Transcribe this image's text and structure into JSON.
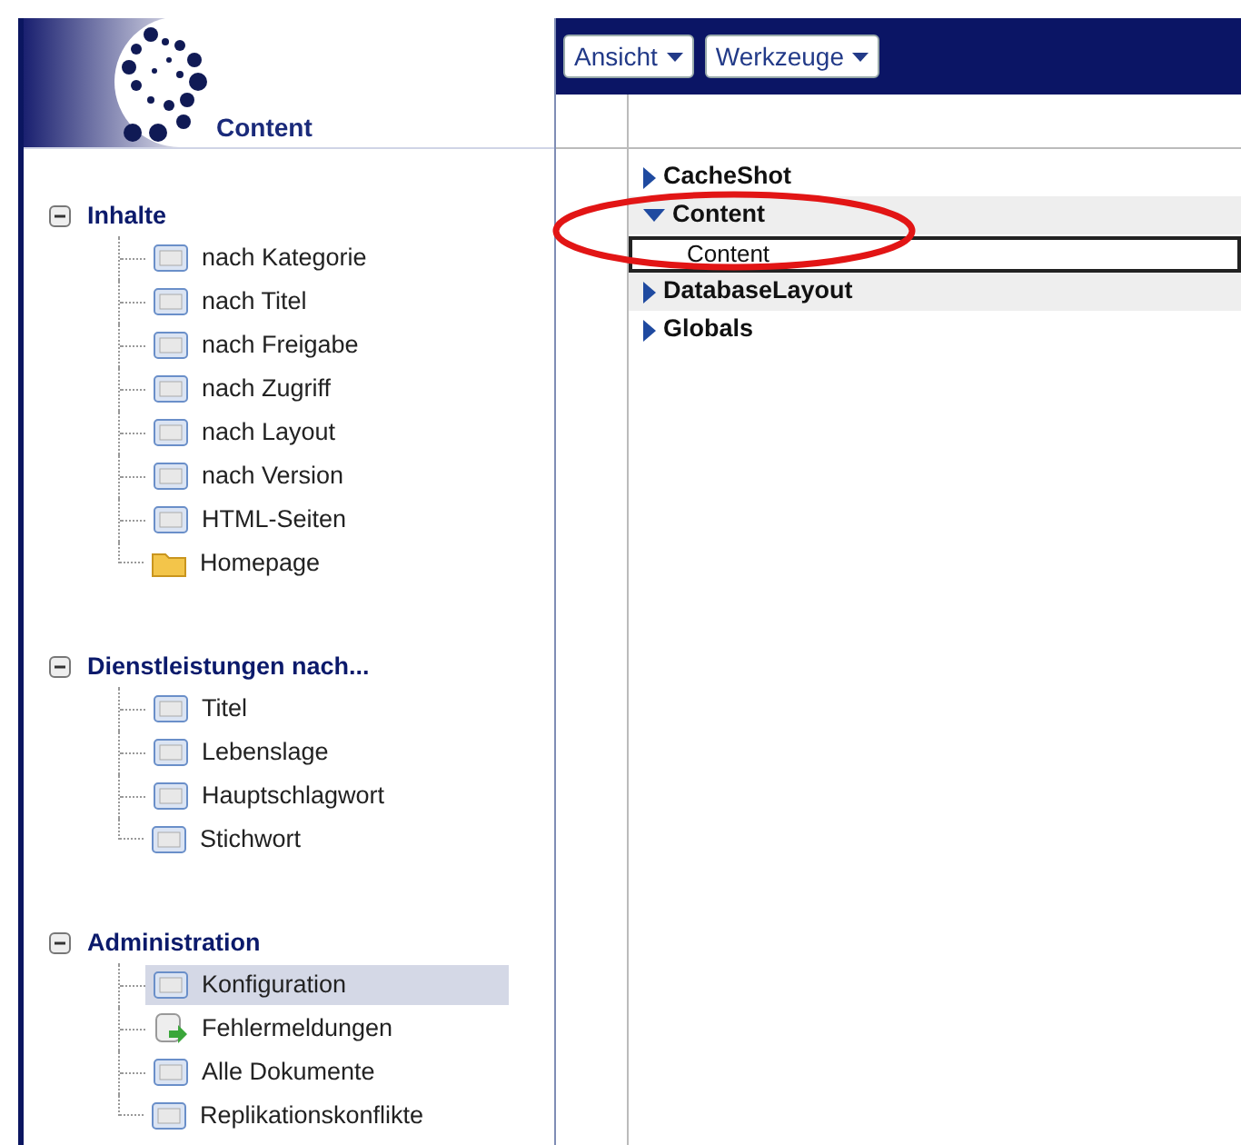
{
  "logo": {
    "title": "Content"
  },
  "sidebar": {
    "sections": [
      {
        "title": "Inhalte",
        "expanded": true,
        "items": [
          {
            "label": "nach Kategorie",
            "kind": "view",
            "selected": false
          },
          {
            "label": "nach Titel",
            "kind": "view",
            "selected": false
          },
          {
            "label": "nach Freigabe",
            "kind": "view",
            "selected": false
          },
          {
            "label": "nach Zugriff",
            "kind": "view",
            "selected": false
          },
          {
            "label": "nach Layout",
            "kind": "view",
            "selected": false
          },
          {
            "label": "nach Version",
            "kind": "view",
            "selected": false
          },
          {
            "label": "HTML-Seiten",
            "kind": "view",
            "selected": false
          },
          {
            "label": "Homepage",
            "kind": "folder",
            "selected": false
          }
        ]
      },
      {
        "title": "Dienstleistungen nach...",
        "expanded": true,
        "items": [
          {
            "label": "Titel",
            "kind": "view",
            "selected": false
          },
          {
            "label": "Lebenslage",
            "kind": "view",
            "selected": false
          },
          {
            "label": "Hauptschlagwort",
            "kind": "view",
            "selected": false
          },
          {
            "label": "Stichwort",
            "kind": "view",
            "selected": false
          }
        ]
      },
      {
        "title": "Administration",
        "expanded": true,
        "items": [
          {
            "label": "Konfiguration",
            "kind": "view",
            "selected": true
          },
          {
            "label": "Fehlermeldungen",
            "kind": "log",
            "selected": false
          },
          {
            "label": "Alle Dokumente",
            "kind": "view",
            "selected": false
          },
          {
            "label": "Replikationskonflikte",
            "kind": "view",
            "selected": false
          }
        ]
      }
    ]
  },
  "menus": [
    {
      "label": "Ansicht"
    },
    {
      "label": "Werkzeuge"
    }
  ],
  "categories": [
    {
      "label": "CacheShot",
      "expanded": false
    },
    {
      "label": "Content",
      "expanded": true,
      "children": [
        {
          "label": "Content",
          "selected": true
        }
      ]
    },
    {
      "label": "DatabaseLayout",
      "expanded": false
    },
    {
      "label": "Globals",
      "expanded": false
    }
  ]
}
